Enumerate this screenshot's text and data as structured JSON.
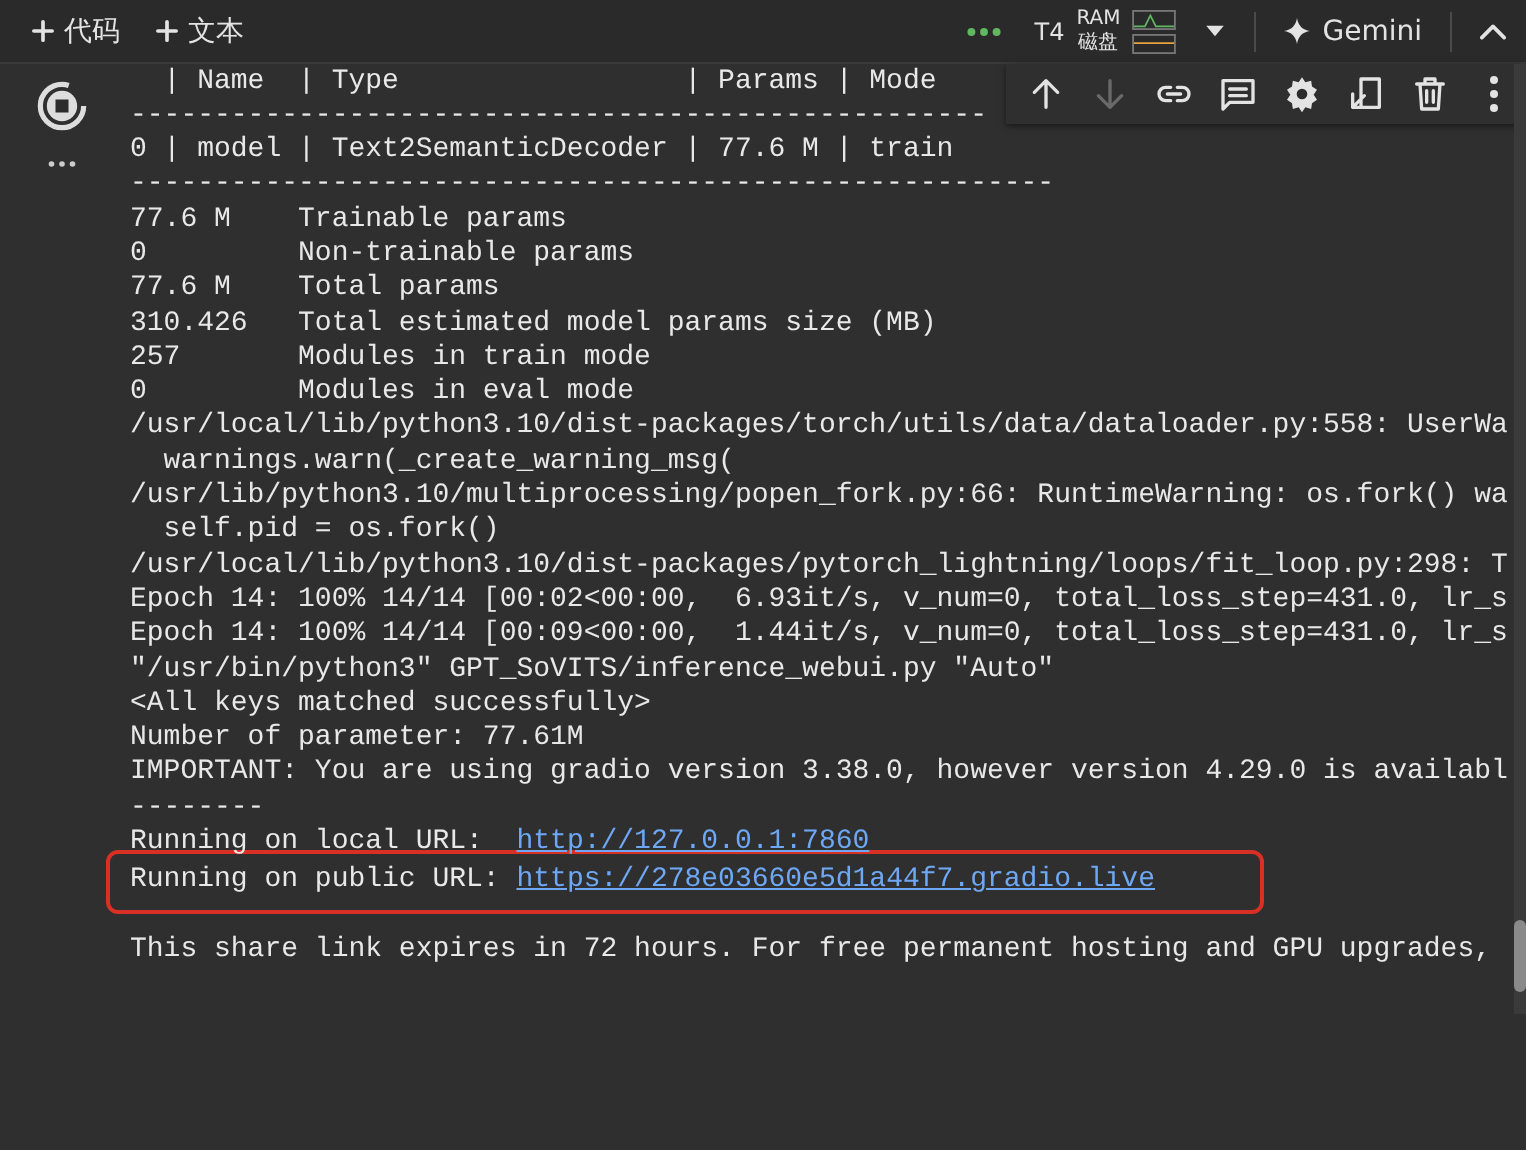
{
  "toolbar": {
    "insert_buttons": [
      {
        "label": "代码"
      },
      {
        "label": "文本"
      }
    ],
    "runtime": {
      "gpu": "T4",
      "ram_label": "RAM",
      "disk_label": "磁盘"
    },
    "gemini_label": "Gemini"
  },
  "cell": {
    "running": true,
    "actions": [
      {
        "kind": "up",
        "disabled": false
      },
      {
        "kind": "down",
        "disabled": true
      },
      {
        "kind": "link",
        "disabled": false
      },
      {
        "kind": "comment",
        "disabled": false
      },
      {
        "kind": "settings",
        "disabled": false
      },
      {
        "kind": "tab",
        "disabled": false
      },
      {
        "kind": "delete",
        "disabled": false
      },
      {
        "kind": "more",
        "disabled": false
      }
    ],
    "output": [
      {
        "kind": "text",
        "text": "  | Name  | Type                 | Params | Mode"
      },
      {
        "kind": "text",
        "text": "---------------------------------------------------"
      },
      {
        "kind": "text",
        "text": "0 | model | Text2SemanticDecoder | 77.6 M | train"
      },
      {
        "kind": "text",
        "text": "-------------------------------------------------------"
      },
      {
        "kind": "text",
        "text": "77.6 M    Trainable params"
      },
      {
        "kind": "text",
        "text": "0         Non-trainable params"
      },
      {
        "kind": "text",
        "text": "77.6 M    Total params"
      },
      {
        "kind": "text",
        "text": "310.426   Total estimated model params size (MB)"
      },
      {
        "kind": "text",
        "text": "257       Modules in train mode"
      },
      {
        "kind": "text",
        "text": "0         Modules in eval mode"
      },
      {
        "kind": "text",
        "text": "/usr/local/lib/python3.10/dist-packages/torch/utils/data/dataloader.py:558: UserWa"
      },
      {
        "kind": "text",
        "text": "  warnings.warn(_create_warning_msg("
      },
      {
        "kind": "text",
        "text": "/usr/lib/python3.10/multiprocessing/popen_fork.py:66: RuntimeWarning: os.fork() wa"
      },
      {
        "kind": "text",
        "text": "  self.pid = os.fork()"
      },
      {
        "kind": "text",
        "text": "/usr/local/lib/python3.10/dist-packages/pytorch_lightning/loops/fit_loop.py:298: T"
      },
      {
        "kind": "text",
        "text": "Epoch 14: 100% 14/14 [00:02<00:00,  6.93it/s, v_num=0, total_loss_step=431.0, lr_s"
      },
      {
        "kind": "text",
        "text": "Epoch 14: 100% 14/14 [00:09<00:00,  1.44it/s, v_num=0, total_loss_step=431.0, lr_s"
      },
      {
        "kind": "text",
        "text": "\"/usr/bin/python3\" GPT_SoVITS/inference_webui.py \"Auto\""
      },
      {
        "kind": "text",
        "text": "<All keys matched successfully>"
      },
      {
        "kind": "text",
        "text": "Number of parameter: 77.61M"
      },
      {
        "kind": "text",
        "text": "IMPORTANT: You are using gradio version 3.38.0, however version 4.29.0 is availabl"
      },
      {
        "kind": "text",
        "text": "--------"
      },
      {
        "kind": "url",
        "label": "Running on local URL:  ",
        "url": "http://127.0.0.1:7860"
      },
      {
        "kind": "url",
        "label": "Running on public URL: ",
        "url": "https://278e03660e5d1a44f7.gradio.live",
        "highlighted": true
      },
      {
        "kind": "text",
        "text": "This share link expires in 72 hours. For free permanent hosting and GPU upgrades,"
      }
    ]
  }
}
